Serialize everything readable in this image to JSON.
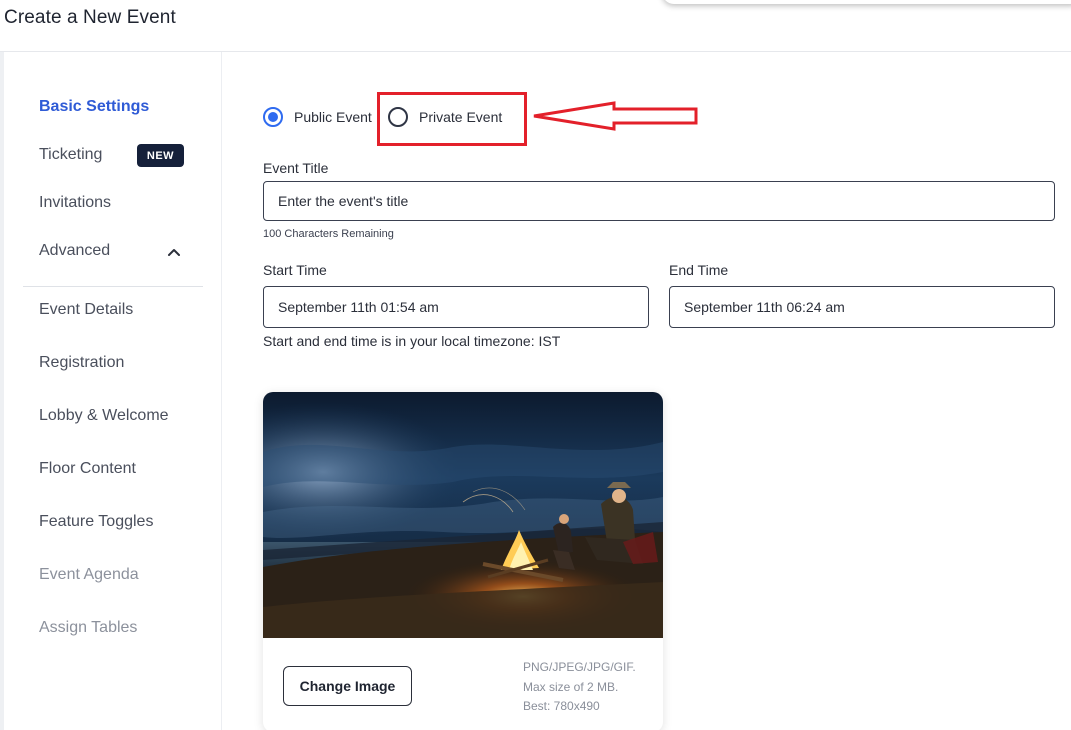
{
  "page": {
    "title": "Create a New Event"
  },
  "sidebar": {
    "items": [
      {
        "label": "Basic Settings",
        "state": "active"
      },
      {
        "label": "Ticketing",
        "badge": "NEW"
      },
      {
        "label": "Invitations"
      },
      {
        "label": "Advanced",
        "expanded": true
      },
      {
        "label": "Event Details"
      },
      {
        "label": "Registration"
      },
      {
        "label": "Lobby & Welcome"
      },
      {
        "label": "Floor Content"
      },
      {
        "label": "Feature Toggles"
      },
      {
        "label": "Event Agenda",
        "state": "disabled"
      },
      {
        "label": "Assign Tables",
        "state": "disabled"
      }
    ]
  },
  "visibility": {
    "public_label": "Public Event",
    "private_label": "Private Event",
    "selected": "public"
  },
  "form": {
    "title_label": "Event Title",
    "title_placeholder": "Enter the event's title",
    "title_helper": "100 Characters Remaining",
    "start_label": "Start Time",
    "start_value": "September 11th 01:54 am",
    "end_label": "End Time",
    "end_value": "September 11th 06:24 am",
    "timezone_note": "Start and end time is in your local timezone: IST"
  },
  "image_card": {
    "button_label": "Change Image",
    "hint_formats": "PNG/JPEG/JPG/GIF.",
    "hint_size": "Max size of 2 MB.",
    "hint_best": "Best: 780x490"
  },
  "annotation": {
    "color": "#e3202a"
  },
  "colors": {
    "accent": "#2f6bf0",
    "active_nav": "#2f5bd6",
    "badge_bg": "#15203a"
  }
}
